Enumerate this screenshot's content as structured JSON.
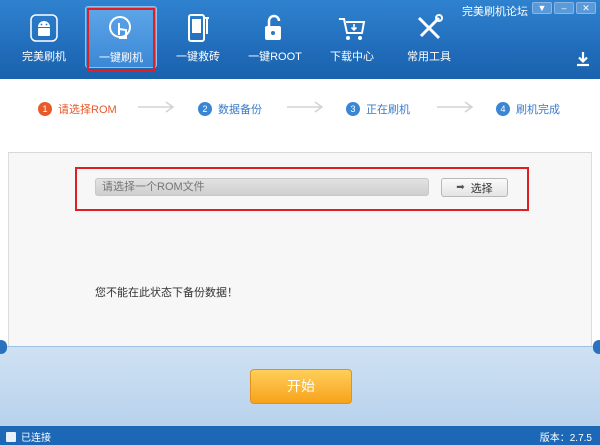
{
  "window": {
    "forum_link": "完美刷机论坛",
    "buttons": [
      "▼",
      "–",
      "✕"
    ]
  },
  "nav": {
    "items": [
      {
        "label": "完美刷机",
        "icon": "android-icon"
      },
      {
        "label": "一键刷机",
        "icon": "flash-hand-icon",
        "active": true
      },
      {
        "label": "一键救砖",
        "icon": "phone-rescue-icon"
      },
      {
        "label": "一键ROOT",
        "icon": "unlock-icon"
      },
      {
        "label": "下载中心",
        "icon": "cart-icon"
      },
      {
        "label": "常用工具",
        "icon": "tools-icon"
      }
    ]
  },
  "steps": [
    {
      "num": "1",
      "label": "请选择ROM"
    },
    {
      "num": "2",
      "label": "数据备份"
    },
    {
      "num": "3",
      "label": "正在刷机"
    },
    {
      "num": "4",
      "label": "刷机完成"
    }
  ],
  "main": {
    "rom_placeholder": "请选择一个ROM文件",
    "choose_label": "选择",
    "warning": "您不能在此状态下备份数据！"
  },
  "bottom": {
    "start_label": "开始"
  },
  "status": {
    "connection": "已连接",
    "version": "版本：2.7.5"
  },
  "colors": {
    "accent": "#1f6ab8",
    "active_step": "#e85a2a",
    "start_button": "#f7a21a",
    "highlight_box": "#e02020"
  }
}
